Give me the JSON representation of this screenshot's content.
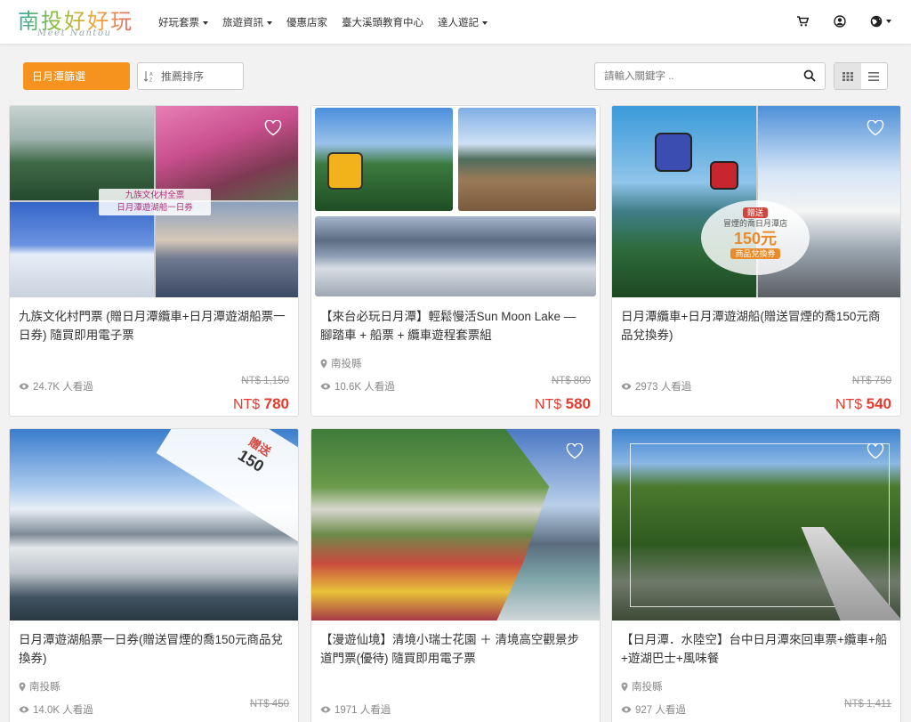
{
  "header": {
    "logo_text": "南投好好玩",
    "logo_sub": "Meet Nantou",
    "nav": [
      {
        "label": "好玩套票",
        "dropdown": true
      },
      {
        "label": "旅遊資訊",
        "dropdown": true
      },
      {
        "label": "優惠店家",
        "dropdown": false
      },
      {
        "label": "臺大溪頭教育中心",
        "dropdown": false
      },
      {
        "label": "達人遊記",
        "dropdown": true
      }
    ],
    "icons": [
      "cart-icon",
      "user-icon",
      "globe-icon"
    ]
  },
  "toolbar": {
    "region_label": "日月潭篩選",
    "sort_label": "推薦排序",
    "search_placeholder": "請輸入關鍵字 ..",
    "view_modes": [
      "grid",
      "list"
    ],
    "active_view": "grid"
  },
  "cards": [
    {
      "title": "九族文化村門票 (贈日月潭纜車+日月潭遊湖船票一日券) 隨買即用電子票",
      "location": "",
      "views": "24.7K 人看過",
      "original_price": "NT$ 1,150",
      "price_prefix": "NT$",
      "price": "780",
      "image_overlay_text": [
        "九族文化村全票",
        "日月潭遊湖船一日券"
      ]
    },
    {
      "title": "【來台必玩日月潭】輕鬆慢活Sun Moon Lake — 腳踏車 + 船票 + 纜車遊程套票組",
      "location": "南投縣",
      "views": "10.6K 人看過",
      "original_price": "NT$ 800",
      "price_prefix": "NT$",
      "price": "580",
      "image_overlay_text": []
    },
    {
      "title": "日月潭纜車+日月潭遊湖船(贈送冒煙的喬150元商品兌換券)",
      "location": "",
      "views": "2973 人看過",
      "original_price": "NT$ 750",
      "price_prefix": "NT$",
      "price": "540",
      "image_overlay_text": [
        "贈送",
        "冒煙的喬日月潭店",
        "150元",
        "商品兌換券"
      ]
    },
    {
      "title": "日月潭遊湖船票一日券(贈送冒煙的喬150元商品兌換券)",
      "location": "南投縣",
      "views": "14.0K 人看過",
      "original_price": "NT$ 450",
      "price_prefix": "NT$",
      "price": "",
      "image_overlay_text": [
        "贈送",
        "150"
      ]
    },
    {
      "title": "【漫遊仙境】清境小瑞士花園 ＋ 清境高空觀景步道門票(優待) 隨買即用電子票",
      "location": "",
      "views": "1971 人看過",
      "original_price": "",
      "price_prefix": "",
      "price": "",
      "image_overlay_text": []
    },
    {
      "title": "【日月潭．水陸空】台中日月潭來回車票+纜車+船+遊湖巴士+風味餐",
      "location": "南投縣",
      "views": "927 人看過",
      "original_price": "NT$ 1,411",
      "price_prefix": "",
      "price": "",
      "image_overlay_text": []
    }
  ],
  "colors": {
    "accent_orange": "#f6931e",
    "price_red": "#e83a2d",
    "muted_text": "#888888"
  }
}
